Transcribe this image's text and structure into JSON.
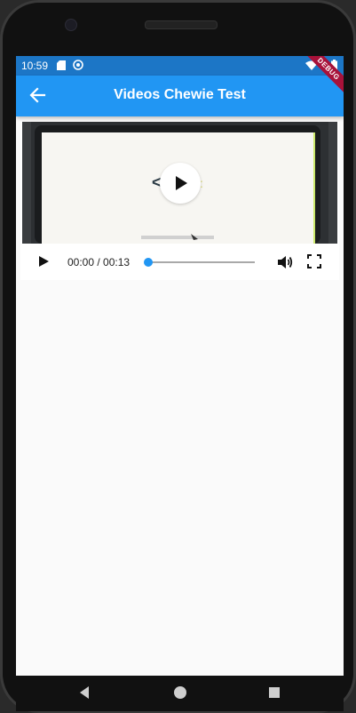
{
  "status_bar": {
    "time": "10:59",
    "icons": [
      "sd-card-icon",
      "sync-icon",
      "wifi-icon",
      "battery-icon"
    ]
  },
  "debug_banner": "DEBUG",
  "app_bar": {
    "title": "Videos Chewie Test",
    "back_icon": "arrow-back-icon"
  },
  "video_player": {
    "overlay_icon": "play-icon",
    "controls": {
      "play_icon": "play-icon",
      "time": "00:00 / 00:13",
      "progress": 0,
      "volume_icon": "volume-icon",
      "fullscreen_icon": "fullscreen-icon"
    }
  },
  "navigation": [
    "back-triangle-icon",
    "home-circle-icon",
    "recents-square-icon"
  ],
  "colors": {
    "status_bar": "#1c76c6",
    "app_bar": "#2196f3",
    "accent": "#2196f3",
    "background": "#fafafa"
  }
}
